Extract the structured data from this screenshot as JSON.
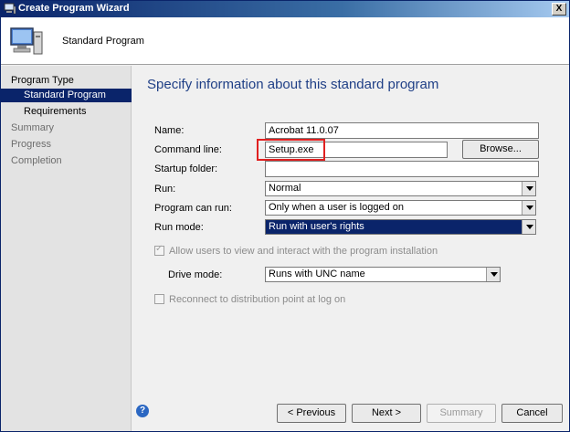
{
  "window": {
    "title": "Create Program Wizard",
    "close_glyph": "X"
  },
  "header": {
    "text": "Standard Program"
  },
  "sidebar": {
    "items": [
      {
        "label": "Program Type"
      },
      {
        "label": "Standard Program"
      },
      {
        "label": "Requirements"
      },
      {
        "label": "Summary"
      },
      {
        "label": "Progress"
      },
      {
        "label": "Completion"
      }
    ]
  },
  "page": {
    "title": "Specify information about this standard program"
  },
  "form": {
    "name": {
      "label": "Name:",
      "value": "Acrobat 11.0.07"
    },
    "command_line": {
      "label": "Command line:",
      "value": "Setup.exe",
      "browse_label": "Browse..."
    },
    "startup_folder": {
      "label": "Startup folder:",
      "value": ""
    },
    "run": {
      "label": "Run:",
      "value": "Normal"
    },
    "program_can_run": {
      "label": "Program can run:",
      "value": "Only when a user is logged on"
    },
    "run_mode": {
      "label": "Run mode:",
      "value": "Run with user's rights"
    },
    "allow_interact": {
      "label": "Allow users to view and interact with the program installation",
      "checked": true
    },
    "drive_mode": {
      "label": "Drive mode:",
      "value": "Runs with UNC name"
    },
    "reconnect": {
      "label": "Reconnect to distribution point at log on",
      "checked": false
    }
  },
  "footer": {
    "help_glyph": "?",
    "previous_label": "< Previous",
    "next_label": "Next >",
    "summary_label": "Summary",
    "cancel_label": "Cancel"
  },
  "colors": {
    "title_blue": "#1f3f86",
    "active_nav": "#0a246a",
    "highlight_box": "#e02020"
  }
}
